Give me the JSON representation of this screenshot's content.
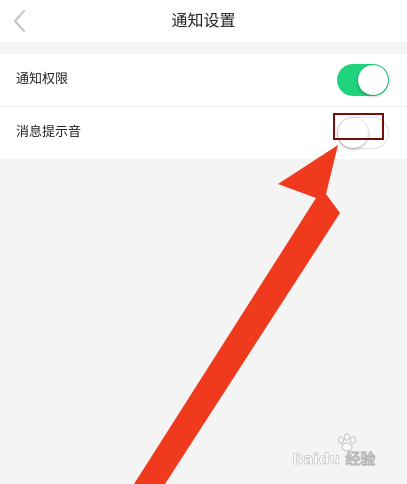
{
  "header": {
    "title": "通知设置",
    "back_icon": "chevron-left-icon"
  },
  "settings": {
    "items": [
      {
        "label": "通知权限",
        "enabled": true
      },
      {
        "label": "消息提示音",
        "enabled": false
      }
    ]
  },
  "colors": {
    "toggle_on": "#1fd47c",
    "annotation_arrow": "#f03a1e",
    "highlight_box": "#7a0b0b"
  },
  "watermark": {
    "brand": "Baidu 经验",
    "icon": "baidu-paw-icon"
  }
}
